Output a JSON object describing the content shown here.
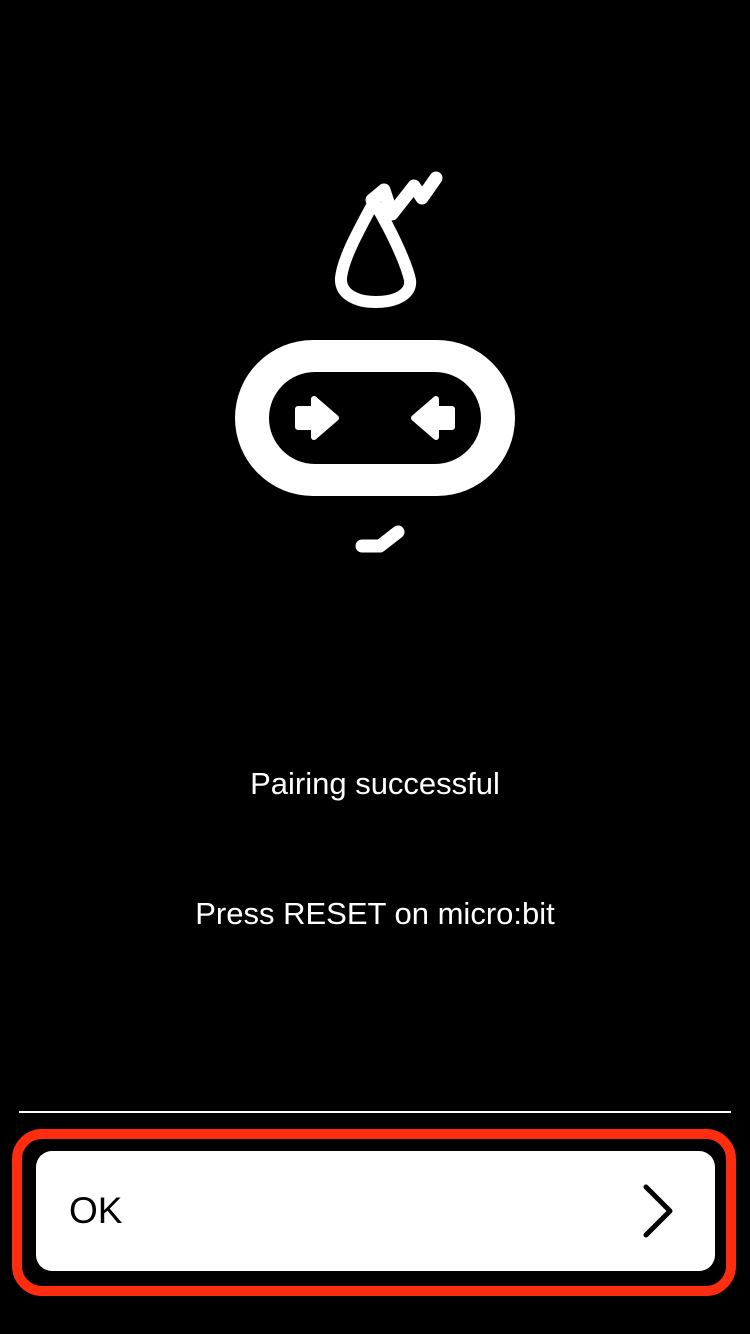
{
  "screen": {
    "background_color": "#000000",
    "logo": {
      "icon": "microbit-logo-icon",
      "color": "#ffffff"
    },
    "message": {
      "title": "Pairing successful",
      "instruction": "Press RESET on micro:bit"
    },
    "ok_button": {
      "label": "OK",
      "icon": "chevron-right-icon",
      "highlight_color": "#ff2d0f"
    }
  }
}
